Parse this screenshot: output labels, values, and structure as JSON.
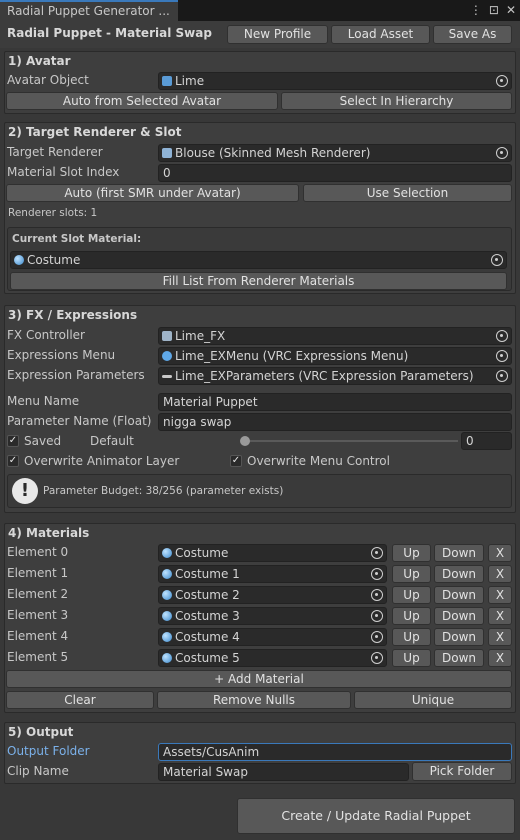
{
  "window": {
    "tab_title": "Radial Puppet Generator ...",
    "icons": [
      "menu-dots-icon",
      "maximize-icon",
      "close-icon"
    ]
  },
  "header": {
    "title": "Radial Puppet - Material Swap",
    "new_profile": "New Profile",
    "load_asset": "Load Asset",
    "save_as": "Save As"
  },
  "avatar": {
    "title": "1) Avatar",
    "object_label": "Avatar Object",
    "object_value": "Lime",
    "auto_button": "Auto from Selected Avatar",
    "select_button": "Select In Hierarchy"
  },
  "target": {
    "title": "2) Target Renderer & Slot",
    "renderer_label": "Target Renderer",
    "renderer_value": "Blouse (Skinned Mesh Renderer)",
    "slot_label": "Material Slot Index",
    "slot_value": "0",
    "auto_button": "Auto (first SMR under Avatar)",
    "use_selection": "Use Selection",
    "slots_info": "Renderer slots: 1",
    "current_label": "Current Slot Material:",
    "current_value": "Costume",
    "fill_button": "Fill List From Renderer Materials"
  },
  "fx": {
    "title": "3) FX / Expressions",
    "controller_label": "FX Controller",
    "controller_value": "Lime_FX",
    "menu_label": "Expressions Menu",
    "menu_value": "Lime_EXMenu (VRC Expressions Menu)",
    "params_label": "Expression Parameters",
    "params_value": "Lime_EXParameters (VRC Expression Parameters)",
    "menu_name_label": "Menu Name",
    "menu_name_value": "Material Puppet",
    "param_name_label": "Parameter Name (Float)",
    "param_name_value": "nigga swap",
    "saved_label": "Saved",
    "saved_checked": true,
    "default_label": "Default",
    "default_value": "0",
    "default_slider": 0,
    "overwrite_layer_label": "Overwrite Animator Layer",
    "overwrite_layer_checked": true,
    "overwrite_menu_label": "Overwrite Menu Control",
    "overwrite_menu_checked": true,
    "budget_text": "Parameter Budget: 38/256 (parameter exists)"
  },
  "materials": {
    "title": "4) Materials",
    "up_label": "Up",
    "down_label": "Down",
    "remove_label": "X",
    "items": [
      {
        "label": "Element 0",
        "value": "Costume"
      },
      {
        "label": "Element 1",
        "value": "Costume 1"
      },
      {
        "label": "Element 2",
        "value": "Costume 2"
      },
      {
        "label": "Element 3",
        "value": "Costume 3"
      },
      {
        "label": "Element 4",
        "value": "Costume 4"
      },
      {
        "label": "Element 5",
        "value": "Costume 5"
      }
    ],
    "add_button": "+ Add Material",
    "clear_button": "Clear",
    "remove_nulls": "Remove Nulls",
    "unique_button": "Unique"
  },
  "output": {
    "title": "5) Output",
    "folder_label": "Output Folder",
    "folder_value": "Assets/CusAnim",
    "clip_label": "Clip Name",
    "clip_value": "Material Swap",
    "pick_folder": "Pick Folder",
    "create_button": "Create / Update Radial Puppet"
  }
}
